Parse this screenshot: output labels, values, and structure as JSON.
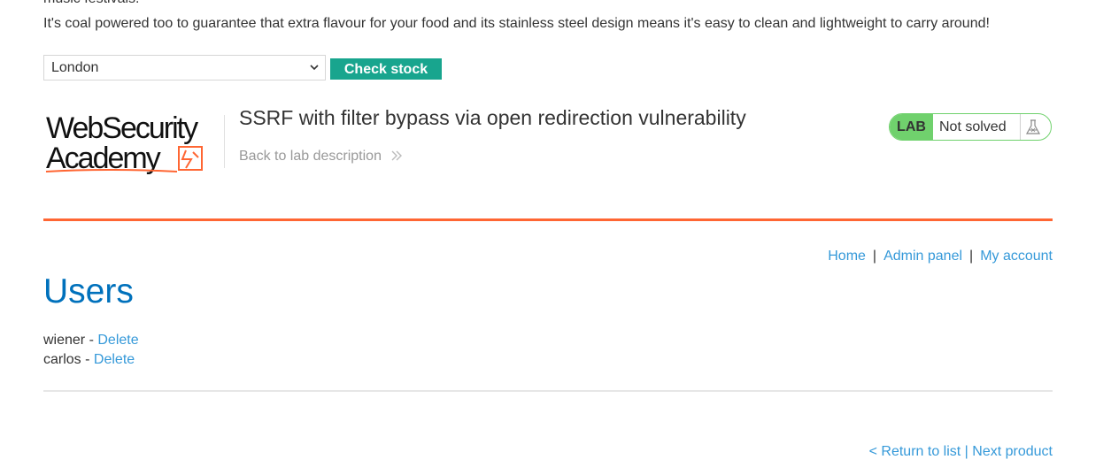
{
  "product": {
    "clipped_text": "music festivals.",
    "description": "It's coal powered too to guarantee that extra flavour for your food and its stainless steel design means it's easy to clean and lightweight to carry around!",
    "stock_select": {
      "value": "London"
    },
    "check_stock_label": "Check stock"
  },
  "lab_header": {
    "logo_text_line1": "WebSecurity",
    "logo_text_line2": "Academy",
    "title": "SSRF with filter bypass via open redirection vulnerability",
    "back_link": "Back to lab description",
    "badge_label": "LAB",
    "badge_status": "Not solved",
    "colors": {
      "accent_orange": "#ff6633",
      "lab_green": "#70d16d",
      "link_blue": "#3599d9",
      "heading_blue": "#0071bc"
    }
  },
  "nav": {
    "home": "Home",
    "admin_panel": "Admin panel",
    "my_account": "My account",
    "separator": "|"
  },
  "page": {
    "title": "Users",
    "users": [
      {
        "name": "wiener",
        "dash": "-",
        "action": "Delete"
      },
      {
        "name": "carlos",
        "dash": "-",
        "action": "Delete"
      }
    ]
  },
  "footer": {
    "return_link": "< Return to list",
    "separator": "|",
    "next_link": "Next product"
  }
}
